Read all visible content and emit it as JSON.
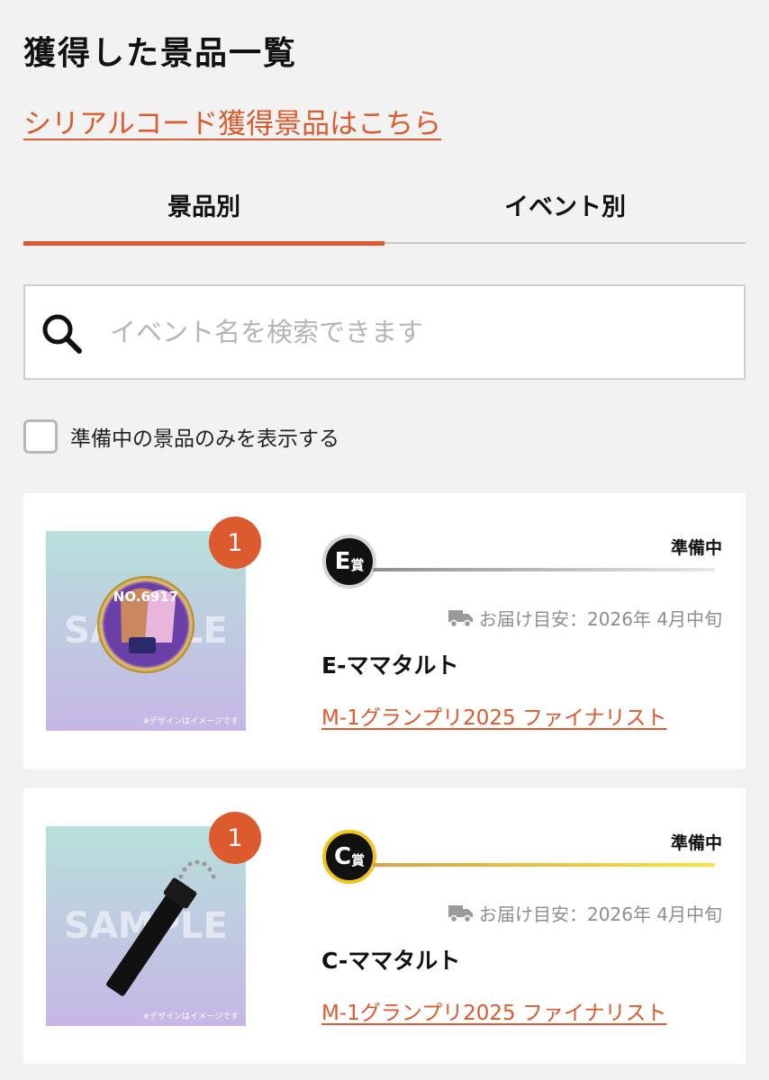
{
  "page": {
    "title": "獲得した景品一覧"
  },
  "serial_link": "シリアルコード獲得景品はこちら",
  "tabs": [
    {
      "label": "景品別",
      "active": true
    },
    {
      "label": "イベント別",
      "active": false
    }
  ],
  "search": {
    "placeholder": "イベント名を検索できます",
    "icon": "search-icon"
  },
  "filter": {
    "label": "準備中の景品のみを表示する",
    "checked": false
  },
  "colors": {
    "accent": "#dd5a2e",
    "gold": "#f3c41a"
  },
  "prizes": [
    {
      "count": "1",
      "grade_letter": "E",
      "grade_sub": "賞",
      "status": "準備中",
      "delivery": "お届け目安：2026年 4月中旬",
      "name": "E-ママタルト",
      "event": "M-1グランプリ2025 ファイナリスト",
      "image_watermark": "SAMPLE",
      "image_note": "※デザインはイメージです",
      "badge_text": "NO.6917"
    },
    {
      "count": "1",
      "grade_letter": "C",
      "grade_sub": "賞",
      "status": "準備中",
      "delivery": "お届け目安：2026年 4月中旬",
      "name": "C-ママタルト",
      "event": "M-1グランプリ2025 ファイナリスト",
      "image_watermark": "SAMPLE",
      "image_note": "※デザインはイメージです"
    }
  ]
}
